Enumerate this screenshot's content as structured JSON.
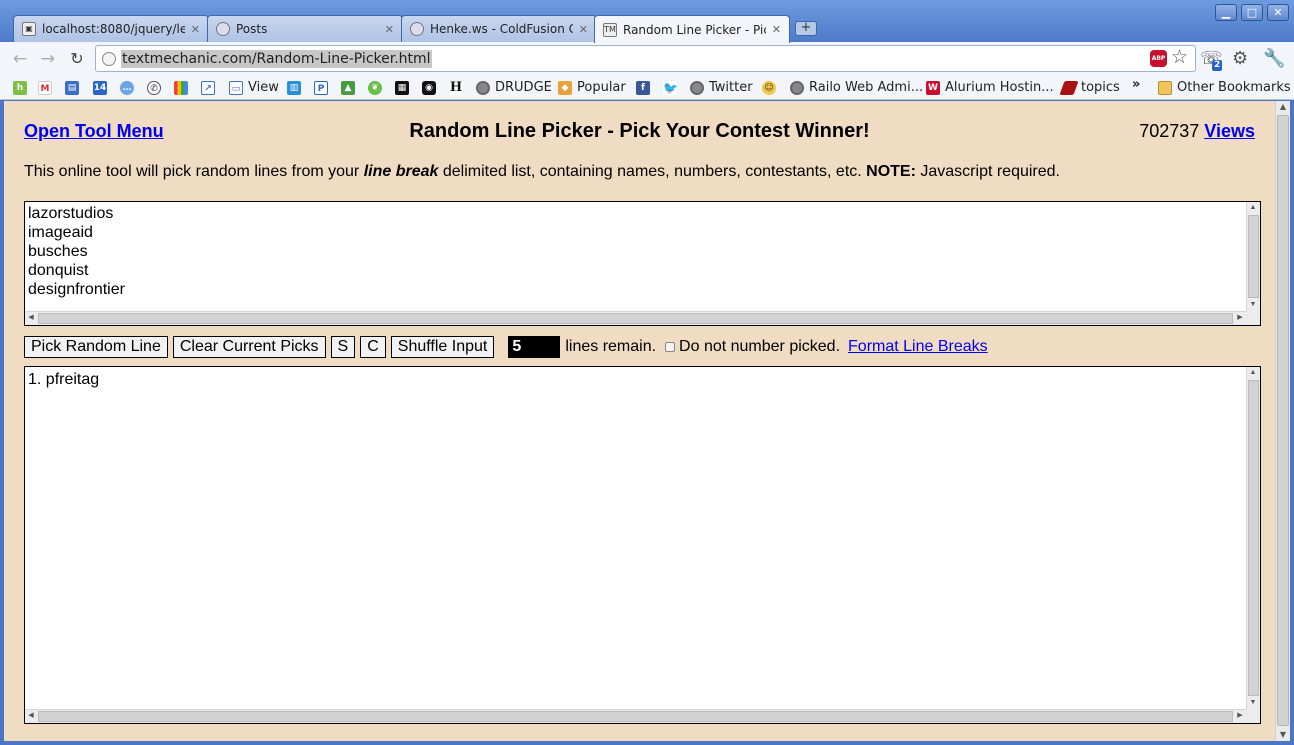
{
  "browser": {
    "tabs": [
      {
        "title": "localhost:8080/jquery/le",
        "favicon": "image-icon"
      },
      {
        "title": "Posts",
        "favicon": "globe-icon"
      },
      {
        "title": "Henke.ws - ColdFusion C",
        "favicon": "globe-icon"
      },
      {
        "title": "Random Line Picker - Pic",
        "favicon": "textmechanic-icon",
        "active": true
      }
    ],
    "url": "textmechanic.com/Random-Line-Picker.html",
    "extension_badge": "2",
    "abp_label": "ABP",
    "bookmarks": [
      {
        "label": "View"
      },
      {
        "label": "DRUDGE"
      },
      {
        "label": "Popular"
      },
      {
        "label": "Twitter"
      },
      {
        "label": "Railo Web Admi..."
      },
      {
        "label": "Alurium Hostin..."
      },
      {
        "label": "topics"
      },
      {
        "label": "Other Bookmarks"
      }
    ],
    "bookmark_icons": {
      "calendar_day": "14",
      "heraldry": "H"
    },
    "overflow_chevron": "»"
  },
  "page": {
    "open_tool_menu": "Open Tool Menu",
    "title": "Random Line Picker - Pick Your Contest Winner!",
    "view_count": "702737",
    "views_link": "Views",
    "intro": {
      "part1": "This online tool will pick random lines from your ",
      "emphasis": "line break",
      "part2": " delimited list, containing names, numbers, contestants, etc. ",
      "note_label": "NOTE:",
      "part3": " Javascript required."
    },
    "input_lines": "lazorstudios\nimageaid\nbusches\ndonquist\ndesignfrontier",
    "buttons": {
      "pick": "Pick Random Line",
      "clear": "Clear Current Picks",
      "s": "S",
      "c": "C",
      "shuffle": "Shuffle Input"
    },
    "lines_remaining": "5",
    "lines_remain_label": "lines remain.",
    "do_not_number_label": "Do not number picked.",
    "format_link": "Format Line Breaks",
    "output_lines": "1. pfreitag"
  }
}
